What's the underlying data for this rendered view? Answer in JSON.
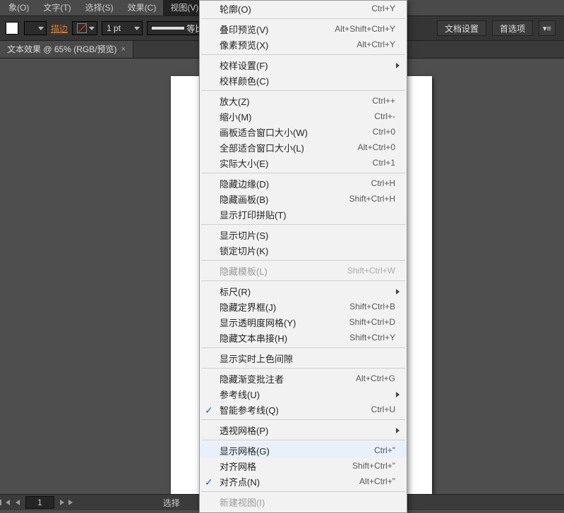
{
  "menubar": {
    "items": [
      "象(O)",
      "文字(T)",
      "选择(S)",
      "效果(C)",
      "视图(V)"
    ]
  },
  "optbar": {
    "stroke_label": "描边",
    "stroke_width": "1 pt",
    "stroke_style": "等比",
    "doc_setup": "文档设置",
    "prefs": "首选项"
  },
  "tab": {
    "title": "文本效果 @ 65% (RGB/预览)"
  },
  "menu": [
    {
      "t": "item",
      "label": "轮廓(O)",
      "sc": "Ctrl+Y"
    },
    {
      "t": "sep"
    },
    {
      "t": "item",
      "label": "叠印预览(V)",
      "sc": "Alt+Shift+Ctrl+Y"
    },
    {
      "t": "item",
      "label": "像素预览(X)",
      "sc": "Alt+Ctrl+Y"
    },
    {
      "t": "sep"
    },
    {
      "t": "item",
      "label": "校样设置(F)",
      "submenu": true
    },
    {
      "t": "item",
      "label": "校样颜色(C)"
    },
    {
      "t": "sep"
    },
    {
      "t": "item",
      "label": "放大(Z)",
      "sc": "Ctrl++"
    },
    {
      "t": "item",
      "label": "缩小(M)",
      "sc": "Ctrl+-"
    },
    {
      "t": "item",
      "label": "画板适合窗口大小(W)",
      "sc": "Ctrl+0"
    },
    {
      "t": "item",
      "label": "全部适合窗口大小(L)",
      "sc": "Alt+Ctrl+0"
    },
    {
      "t": "item",
      "label": "实际大小(E)",
      "sc": "Ctrl+1"
    },
    {
      "t": "sep"
    },
    {
      "t": "item",
      "label": "隐藏边缘(D)",
      "sc": "Ctrl+H"
    },
    {
      "t": "item",
      "label": "隐藏画板(B)",
      "sc": "Shift+Ctrl+H"
    },
    {
      "t": "item",
      "label": "显示打印拼贴(T)"
    },
    {
      "t": "sep"
    },
    {
      "t": "item",
      "label": "显示切片(S)"
    },
    {
      "t": "item",
      "label": "锁定切片(K)"
    },
    {
      "t": "sep"
    },
    {
      "t": "item",
      "label": "隐藏模板(L)",
      "sc": "Shift+Ctrl+W",
      "disabled": true
    },
    {
      "t": "sep"
    },
    {
      "t": "item",
      "label": "标尺(R)",
      "submenu": true
    },
    {
      "t": "item",
      "label": "隐藏定界框(J)",
      "sc": "Shift+Ctrl+B"
    },
    {
      "t": "item",
      "label": "显示透明度网格(Y)",
      "sc": "Shift+Ctrl+D"
    },
    {
      "t": "item",
      "label": "隐藏文本串接(H)",
      "sc": "Shift+Ctrl+Y"
    },
    {
      "t": "sep"
    },
    {
      "t": "item",
      "label": "显示实时上色间隙"
    },
    {
      "t": "sep"
    },
    {
      "t": "item",
      "label": "隐藏渐变批注者",
      "sc": "Alt+Ctrl+G"
    },
    {
      "t": "item",
      "label": "参考线(U)",
      "submenu": true
    },
    {
      "t": "item",
      "label": "智能参考线(Q)",
      "sc": "Ctrl+U",
      "checked": true
    },
    {
      "t": "sep"
    },
    {
      "t": "item",
      "label": "透视网格(P)",
      "submenu": true
    },
    {
      "t": "sep"
    },
    {
      "t": "item",
      "label": "显示网格(G)",
      "sc": "Ctrl+\"",
      "hl": true
    },
    {
      "t": "item",
      "label": "对齐网格",
      "sc": "Shift+Ctrl+\""
    },
    {
      "t": "item",
      "label": "对齐点(N)",
      "sc": "Alt+Ctrl+\"",
      "checked": true
    },
    {
      "t": "sep"
    },
    {
      "t": "item",
      "label": "新建视图(I)",
      "disabled": true
    }
  ],
  "status": {
    "page_value": "1",
    "mode_label": "选择"
  }
}
